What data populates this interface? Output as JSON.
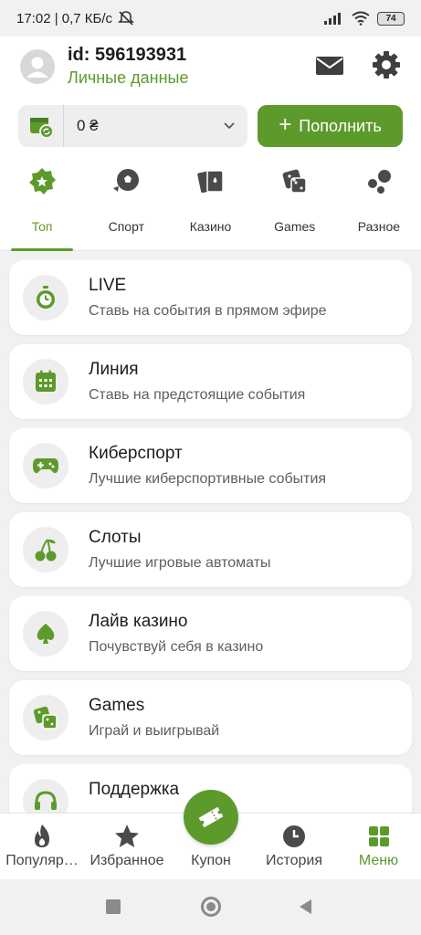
{
  "status_bar": {
    "time_speed": "17:02 | 0,7 КБ/с",
    "battery": "74"
  },
  "header": {
    "user_id": "id: 596193931",
    "personal_link": "Личные данные"
  },
  "wallet": {
    "balance": "0 ₴",
    "topup_label": "Пополнить"
  },
  "tabs": [
    {
      "label": "Топ",
      "active": true,
      "icon": "star-badge-icon"
    },
    {
      "label": "Спорт",
      "active": false,
      "icon": "soccer-ball-icon"
    },
    {
      "label": "Казино",
      "active": false,
      "icon": "cards-icon"
    },
    {
      "label": "Games",
      "active": false,
      "icon": "dice-icon"
    },
    {
      "label": "Разное",
      "active": false,
      "icon": "bubbles-icon"
    }
  ],
  "menu": [
    {
      "title": "LIVE",
      "subtitle": "Ставь на события в прямом эфире",
      "icon": "stopwatch-icon"
    },
    {
      "title": "Линия",
      "subtitle": "Ставь на предстоящие события",
      "icon": "calendar-icon"
    },
    {
      "title": "Киберспорт",
      "subtitle": "Лучшие киберспортивные события",
      "icon": "gamepad-icon"
    },
    {
      "title": "Слоты",
      "subtitle": "Лучшие игровые автоматы",
      "icon": "cherries-icon"
    },
    {
      "title": "Лайв казино",
      "subtitle": "Почувствуй себя в казино",
      "icon": "spade-icon"
    },
    {
      "title": "Games",
      "subtitle": "Играй и выигрывай",
      "icon": "dice-icon"
    },
    {
      "title": "Поддержка",
      "subtitle": "",
      "icon": "headset-icon"
    }
  ],
  "bottom_nav": [
    {
      "label": "Популяр…",
      "icon": "flame-icon",
      "active": false
    },
    {
      "label": "Избранное",
      "icon": "star-icon",
      "active": false
    },
    {
      "label": "Купон",
      "icon": "ticket-icon",
      "active": false
    },
    {
      "label": "История",
      "icon": "clock-icon",
      "active": false
    },
    {
      "label": "Меню",
      "icon": "grid-icon",
      "active": true
    }
  ],
  "colors": {
    "accent": "#5d9a2c",
    "background": "#f1f1f1",
    "card": "#ffffff"
  }
}
